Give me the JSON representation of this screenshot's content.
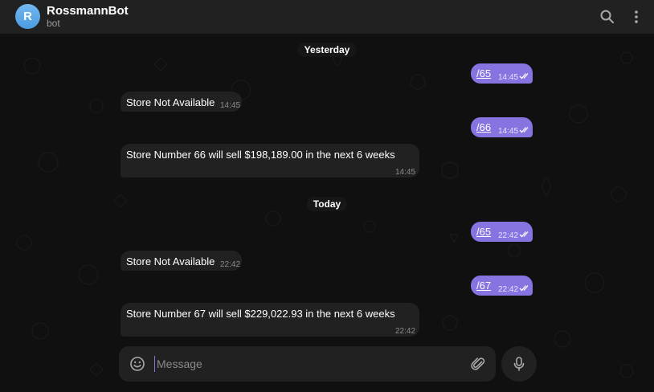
{
  "header": {
    "avatar_letter": "R",
    "title": "RossmannBot",
    "subtitle": "bot",
    "icons": [
      "search-icon",
      "more-vertical-icon"
    ]
  },
  "chat": {
    "separators": [
      "Yesterday",
      "Today"
    ],
    "messages": [
      {
        "direction": "out",
        "text": "/65",
        "time": "14:45",
        "status": "read"
      },
      {
        "direction": "in",
        "text": "Store Not Available",
        "time": "14:45"
      },
      {
        "direction": "out",
        "text": "/66",
        "time": "14:45",
        "status": "read"
      },
      {
        "direction": "in",
        "text": "Store Number 66 will sell $198,189.00 in the next 6 weeks",
        "time": "14:45"
      },
      {
        "direction": "out",
        "text": "/65",
        "time": "22:42",
        "status": "read"
      },
      {
        "direction": "in",
        "text": "Store Not Available",
        "time": "22:42"
      },
      {
        "direction": "out",
        "text": "/67",
        "time": "22:42",
        "status": "read"
      },
      {
        "direction": "in",
        "text": "Store Number 67 will sell $229,022.93 in the next 6 weeks",
        "time": "22:42"
      }
    ]
  },
  "composer": {
    "placeholder": "Message",
    "value": "",
    "icons": [
      "emoji-icon",
      "paperclip-icon",
      "microphone-icon"
    ]
  },
  "colors": {
    "outgoing_bubble": "#8774e1",
    "incoming_bubble": "#212121",
    "header_bg": "#212121",
    "avatar_gradient_top": "#72b8ef",
    "avatar_gradient_bottom": "#4c9be0"
  }
}
